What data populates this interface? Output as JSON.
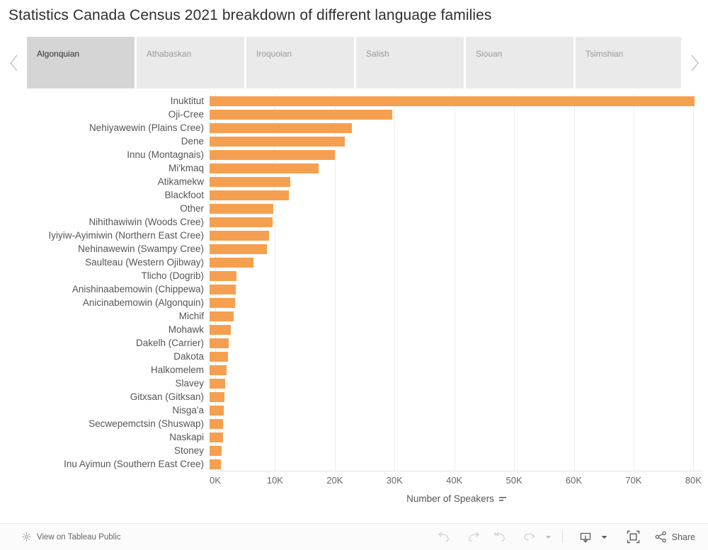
{
  "title": "Statistics Canada Census 2021 breakdown of different language families",
  "tabs": {
    "prev_label": "chevron-left",
    "next_label": "chevron-right",
    "items": [
      {
        "label": "Algonquian",
        "active": true
      },
      {
        "label": "Athabaskan",
        "active": false
      },
      {
        "label": "Iroquoian",
        "active": false
      },
      {
        "label": "Salish",
        "active": false
      },
      {
        "label": "Siouan",
        "active": false
      },
      {
        "label": "Tsimshian",
        "active": false
      },
      {
        "label": "",
        "active": false
      }
    ]
  },
  "chart_data": {
    "type": "bar",
    "orientation": "horizontal",
    "title": "Statistics Canada Census 2021 breakdown of different language families",
    "xlabel": "Number of Speakers",
    "ylabel": "",
    "xlim": [
      0,
      81500
    ],
    "grid": true,
    "legend": false,
    "bar_color": "#f5a050",
    "tick_labels": [
      "0K",
      "10K",
      "20K",
      "30K",
      "40K",
      "50K",
      "60K",
      "70K",
      "80K"
    ],
    "tick_values": [
      0,
      10000,
      20000,
      30000,
      40000,
      50000,
      60000,
      70000,
      80000
    ],
    "categories": [
      "Inuktitut",
      "Oji-Cree",
      "Nehiyawewin (Plains Cree)",
      "Dene",
      "Innu (Montagnais)",
      "Mi'kmaq",
      "Atikamekw",
      "Blackfoot",
      "Other",
      "Nihithawiwin (Woods Cree)",
      "Iyiyiw-Ayimiwin (Northern East Cree)",
      "Nehinawewin (Swampy Cree)",
      "Saulteau (Western Ojibway)",
      "Tlicho (Dogrib)",
      "Anishinaabemowin (Chippewa)",
      "Anicinabemowin (Algonquin)",
      "Michif",
      "Mohawk",
      "Dakelh (Carrier)",
      "Dakota",
      "Halkomelem",
      "Slavey",
      "Gitxsan (Gitksan)",
      "Nisga'a",
      "Secwepemctsin (Shuswap)",
      "Naskapi",
      "Stoney",
      "Inu Ayimun (Southern East Cree)"
    ],
    "values": [
      81200,
      30600,
      23800,
      22600,
      21000,
      18300,
      13500,
      13300,
      10700,
      10500,
      9900,
      9600,
      7400,
      4500,
      4400,
      4300,
      4000,
      3600,
      3200,
      3100,
      2900,
      2600,
      2500,
      2400,
      2300,
      2200,
      2000,
      1900
    ]
  },
  "footer": {
    "tableau_public_label": "View on Tableau Public",
    "tableau_logo": "tableau-logo-icon",
    "undo_label": "undo-icon",
    "redo_label": "redo-icon",
    "reset_label": "reset-icon",
    "refresh_label": "refresh-icon",
    "refresh_caret": "chevron-down-icon",
    "download_label": "download-icon",
    "download_caret": "chevron-down-icon",
    "fullscreen_label": "fullscreen-icon",
    "share_label": "Share",
    "share_icon": "share-icon"
  }
}
